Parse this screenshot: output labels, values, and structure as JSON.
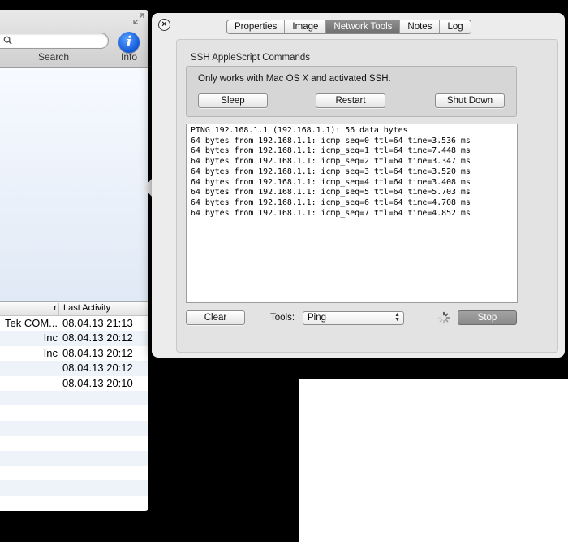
{
  "sidebar_window": {
    "search": {
      "label": "Search",
      "value": ""
    },
    "info": {
      "label": "Info",
      "glyph": "i"
    },
    "table": {
      "columns": [
        "r",
        "Last Activity"
      ],
      "rows": [
        {
          "prev": "Tek COM...",
          "last": "08.04.13 21:13"
        },
        {
          "prev": "Inc",
          "last": "08.04.13 20:12"
        },
        {
          "prev": "Inc",
          "last": "08.04.13 20:12"
        },
        {
          "prev": "",
          "last": "08.04.13 20:12"
        },
        {
          "prev": "",
          "last": "08.04.13 20:10"
        },
        {
          "prev": "",
          "last": ""
        },
        {
          "prev": "",
          "last": ""
        },
        {
          "prev": "",
          "last": ""
        },
        {
          "prev": "",
          "last": ""
        },
        {
          "prev": "",
          "last": ""
        },
        {
          "prev": "",
          "last": ""
        },
        {
          "prev": "",
          "last": ""
        },
        {
          "prev": "",
          "last": ""
        }
      ]
    }
  },
  "popover": {
    "close_glyph": "×",
    "tabs": [
      {
        "label": "Properties",
        "active": false
      },
      {
        "label": "Image",
        "active": false
      },
      {
        "label": "Network Tools",
        "active": true
      },
      {
        "label": "Notes",
        "active": false
      },
      {
        "label": "Log",
        "active": false
      }
    ],
    "ssh": {
      "title": "SSH AppleScript Commands",
      "note": "Only works with Mac OS X and activated SSH.",
      "sleep_label": "Sleep",
      "restart_label": "Restart",
      "shutdown_label": "Shut Down"
    },
    "output_lines": [
      "PING 192.168.1.1 (192.168.1.1): 56 data bytes",
      "64 bytes from 192.168.1.1: icmp_seq=0 ttl=64 time=3.536 ms",
      "64 bytes from 192.168.1.1: icmp_seq=1 ttl=64 time=7.448 ms",
      "64 bytes from 192.168.1.1: icmp_seq=2 ttl=64 time=3.347 ms",
      "64 bytes from 192.168.1.1: icmp_seq=3 ttl=64 time=3.520 ms",
      "64 bytes from 192.168.1.1: icmp_seq=4 ttl=64 time=3.408 ms",
      "64 bytes from 192.168.1.1: icmp_seq=5 ttl=64 time=5.703 ms",
      "64 bytes from 192.168.1.1: icmp_seq=6 ttl=64 time=4.708 ms",
      "64 bytes from 192.168.1.1: icmp_seq=7 ttl=64 time=4.852 ms"
    ],
    "clear_label": "Clear",
    "tools_label": "Tools:",
    "tools_selected": "Ping",
    "stop_label": "Stop"
  },
  "colors": {
    "active_tab": "#7f7f7f",
    "info_blue": "#1a62e0",
    "stop_button": "#969696"
  }
}
